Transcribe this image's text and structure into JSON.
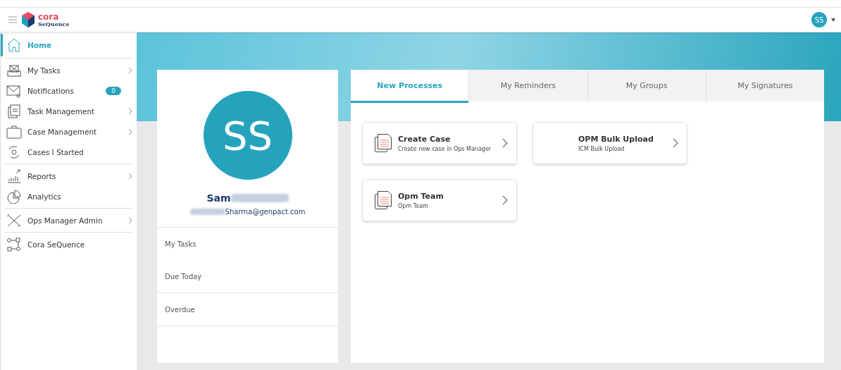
{
  "header": {
    "logo_top": "cora",
    "logo_bottom": "SeQuence",
    "avatar": "SS"
  },
  "sidebar": {
    "groups": [
      {
        "items": [
          {
            "label": "Home",
            "selected": true,
            "has_submenu": false
          }
        ]
      },
      {
        "items": [
          {
            "label": "My Tasks",
            "selected": false,
            "has_submenu": true
          },
          {
            "label": "Notifications",
            "selected": false,
            "has_submenu": false,
            "badge": "0"
          },
          {
            "label": "Task Management",
            "selected": false,
            "has_submenu": true
          },
          {
            "label": "Case Management",
            "selected": false,
            "has_submenu": true
          },
          {
            "label": "Cases I Started",
            "selected": false,
            "has_submenu": false
          }
        ]
      },
      {
        "items": [
          {
            "label": "Reports",
            "selected": false,
            "has_submenu": true
          },
          {
            "label": "Analytics",
            "selected": false,
            "has_submenu": false
          }
        ]
      },
      {
        "items": [
          {
            "label": "Ops Manager Admin",
            "selected": false,
            "has_submenu": true
          }
        ]
      },
      {
        "items": [
          {
            "label": "Cora SeQuence",
            "selected": false,
            "has_submenu": false
          }
        ]
      }
    ]
  },
  "profile": {
    "initials": "SS",
    "name": "Sam",
    "email": "Sharma@genpact.com",
    "stats": [
      {
        "label": "My Tasks"
      },
      {
        "label": "Due Today"
      },
      {
        "label": "Overdue"
      }
    ]
  },
  "tabs": [
    {
      "label": "New Processes",
      "selected": true
    },
    {
      "label": "My Reminders",
      "selected": false
    },
    {
      "label": "My Groups",
      "selected": false
    },
    {
      "label": "My Signatures",
      "selected": false
    }
  ],
  "processes": [
    {
      "title": "Create Case",
      "subtitle": "Create new case in Ops Manager",
      "has_icon": true
    },
    {
      "title": "OPM Bulk Upload",
      "subtitle": "ICM Bulk Upload",
      "has_icon": false
    },
    {
      "title": "Opm Team",
      "subtitle": "Opm Team",
      "has_icon": true
    }
  ]
}
